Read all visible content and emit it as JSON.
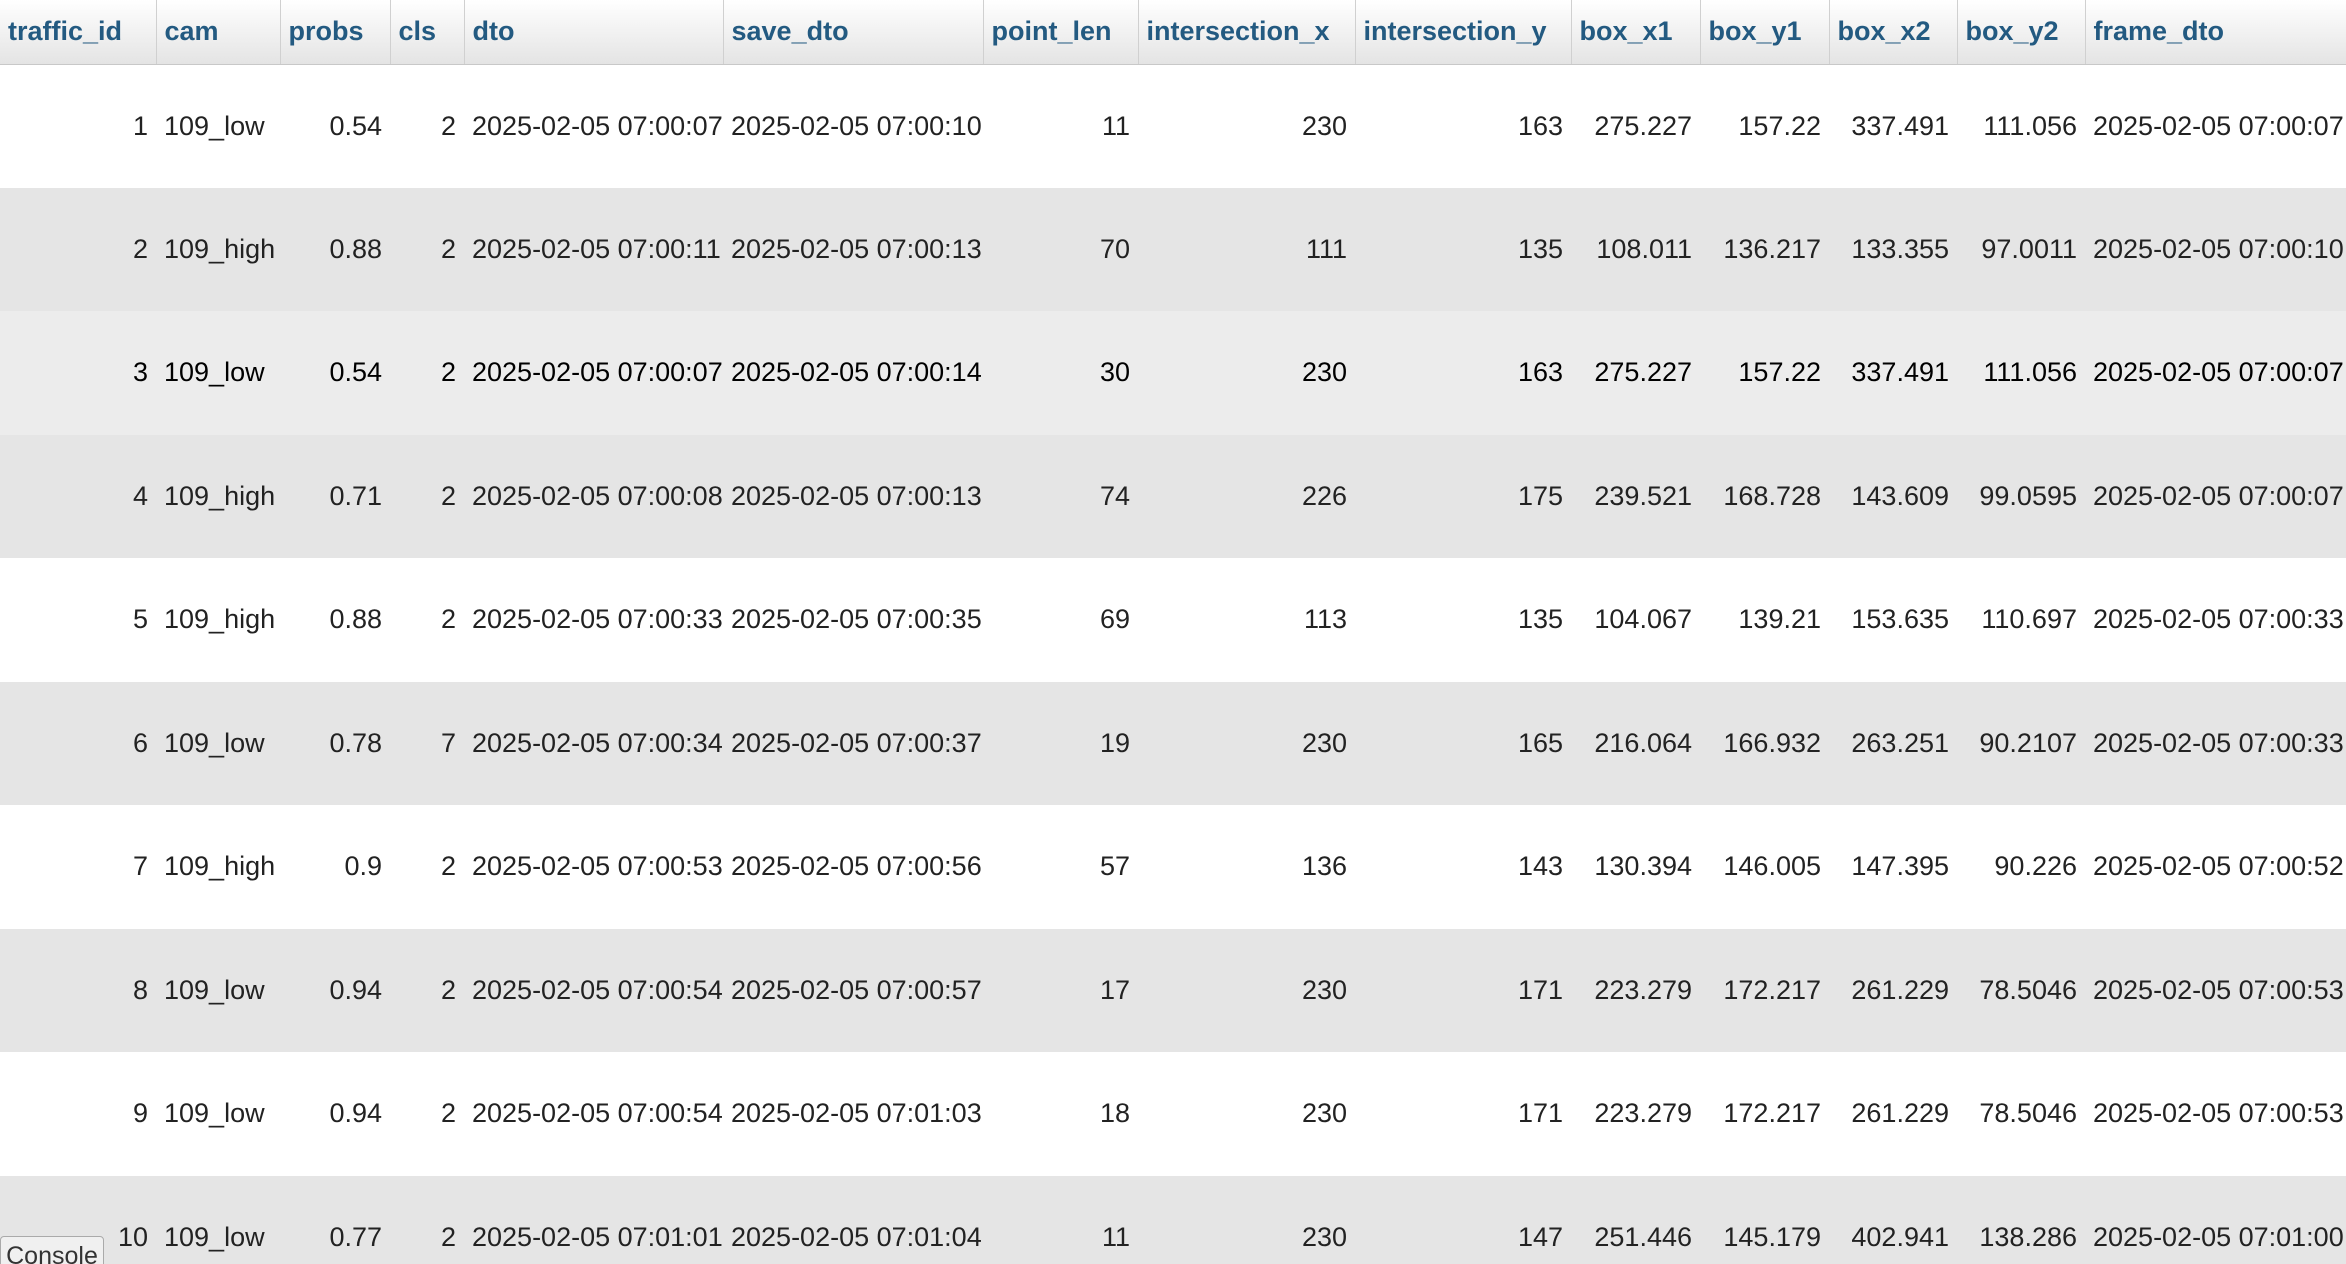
{
  "columns": [
    "traffic_id",
    "cam",
    "probs",
    "cls",
    "dto",
    "save_dto",
    "point_len",
    "intersection_x",
    "intersection_y",
    "box_x1",
    "box_y1",
    "box_x2",
    "box_y2",
    "frame_dto"
  ],
  "rows": [
    [
      "1",
      "109_low",
      "0.54",
      "2",
      "2025-02-05 07:00:07",
      "2025-02-05 07:00:10",
      "11",
      "230",
      "163",
      "275.227",
      "157.22",
      "337.491",
      "111.056",
      "2025-02-05 07:00:07"
    ],
    [
      "2",
      "109_high",
      "0.88",
      "2",
      "2025-02-05 07:00:11",
      "2025-02-05 07:00:13",
      "70",
      "111",
      "135",
      "108.011",
      "136.217",
      "133.355",
      "97.0011",
      "2025-02-05 07:00:10"
    ],
    [
      "3",
      "109_low",
      "0.54",
      "2",
      "2025-02-05 07:00:07",
      "2025-02-05 07:00:14",
      "30",
      "230",
      "163",
      "275.227",
      "157.22",
      "337.491",
      "111.056",
      "2025-02-05 07:00:07"
    ],
    [
      "4",
      "109_high",
      "0.71",
      "2",
      "2025-02-05 07:00:08",
      "2025-02-05 07:00:13",
      "74",
      "226",
      "175",
      "239.521",
      "168.728",
      "143.609",
      "99.0595",
      "2025-02-05 07:00:07"
    ],
    [
      "5",
      "109_high",
      "0.88",
      "2",
      "2025-02-05 07:00:33",
      "2025-02-05 07:00:35",
      "69",
      "113",
      "135",
      "104.067",
      "139.21",
      "153.635",
      "110.697",
      "2025-02-05 07:00:33"
    ],
    [
      "6",
      "109_low",
      "0.78",
      "7",
      "2025-02-05 07:00:34",
      "2025-02-05 07:00:37",
      "19",
      "230",
      "165",
      "216.064",
      "166.932",
      "263.251",
      "90.2107",
      "2025-02-05 07:00:33"
    ],
    [
      "7",
      "109_high",
      "0.9",
      "2",
      "2025-02-05 07:00:53",
      "2025-02-05 07:00:56",
      "57",
      "136",
      "143",
      "130.394",
      "146.005",
      "147.395",
      "90.226",
      "2025-02-05 07:00:52"
    ],
    [
      "8",
      "109_low",
      "0.94",
      "2",
      "2025-02-05 07:00:54",
      "2025-02-05 07:00:57",
      "17",
      "230",
      "171",
      "223.279",
      "172.217",
      "261.229",
      "78.5046",
      "2025-02-05 07:00:53"
    ],
    [
      "9",
      "109_low",
      "0.94",
      "2",
      "2025-02-05 07:00:54",
      "2025-02-05 07:01:03",
      "18",
      "230",
      "171",
      "223.279",
      "172.217",
      "261.229",
      "78.5046",
      "2025-02-05 07:00:53"
    ],
    [
      "10",
      "109_low",
      "0.77",
      "2",
      "2025-02-05 07:01:01",
      "2025-02-05 07:01:04",
      "11",
      "230",
      "147",
      "251.446",
      "145.179",
      "402.941",
      "138.286",
      "2025-02-05 07:01:00"
    ]
  ],
  "console_label": "Console"
}
